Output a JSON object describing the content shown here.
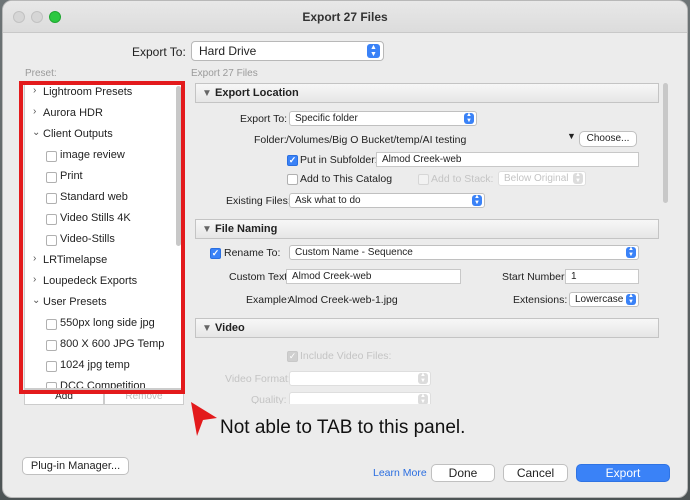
{
  "window": {
    "title": "Export 27 Files"
  },
  "export_to": {
    "label": "Export To:",
    "value": "Hard Drive"
  },
  "preset_caption": "Preset:",
  "right_caption": "Export 27 Files",
  "presets": [
    {
      "label": "Lightroom Presets",
      "type": "folder",
      "state": "collapsed"
    },
    {
      "label": "Aurora HDR",
      "type": "folder",
      "state": "collapsed"
    },
    {
      "label": "Client Outputs",
      "type": "folder",
      "state": "expanded"
    },
    {
      "label": "image review",
      "type": "preset"
    },
    {
      "label": "Print",
      "type": "preset"
    },
    {
      "label": "Standard web",
      "type": "preset"
    },
    {
      "label": "Video Stills 4K",
      "type": "preset"
    },
    {
      "label": "Video-Stills",
      "type": "preset"
    },
    {
      "label": "LRTimelapse",
      "type": "folder",
      "state": "collapsed"
    },
    {
      "label": "Loupedeck Exports",
      "type": "folder",
      "state": "collapsed"
    },
    {
      "label": "User Presets",
      "type": "folder",
      "state": "expanded"
    },
    {
      "label": "550px long side jpg",
      "type": "preset"
    },
    {
      "label": "800 X 600 JPG Temp",
      "type": "preset"
    },
    {
      "label": "1024 jpg temp",
      "type": "preset"
    },
    {
      "label": "DCC Competition",
      "type": "preset"
    }
  ],
  "preset_buttons": {
    "add": "Add",
    "remove": "Remove"
  },
  "annotation": {
    "text": "Not able to TAB to this panel."
  },
  "export_location": {
    "title": "Export Location",
    "export_to_label": "Export To:",
    "export_to_value": "Specific folder",
    "folder_label": "Folder:",
    "folder_path": "/Volumes/Big O Bucket/temp/AI testing",
    "choose_button": "Choose...",
    "subfolder_label": "Put in Subfolder:",
    "subfolder_checked": true,
    "subfolder_value": "Almod Creek-web",
    "add_catalog_label": "Add to This Catalog",
    "add_catalog_checked": false,
    "add_stack_label": "Add to Stack:",
    "stack_position": "Below Original",
    "existing_files_label": "Existing Files:",
    "existing_files_value": "Ask what to do"
  },
  "file_naming": {
    "title": "File Naming",
    "rename_label": "Rename To:",
    "rename_checked": true,
    "rename_template": "Custom Name - Sequence",
    "custom_text_label": "Custom Text:",
    "custom_text_value": "Almod Creek-web",
    "start_number_label": "Start Number:",
    "start_number_value": "1",
    "example_label": "Example:",
    "example_value": "Almod Creek-web-1.jpg",
    "extensions_label": "Extensions:",
    "extensions_value": "Lowercase"
  },
  "video": {
    "title": "Video",
    "include_label": "Include Video Files:",
    "include_checked": true,
    "format_label": "Video Format:",
    "quality_label": "Quality:"
  },
  "footer": {
    "plugin_manager": "Plug-in Manager...",
    "learn_more": "Learn More",
    "done": "Done",
    "cancel": "Cancel",
    "export": "Export"
  },
  "colors": {
    "accent": "#3a82f7",
    "highlight_box": "#e31a1c"
  }
}
